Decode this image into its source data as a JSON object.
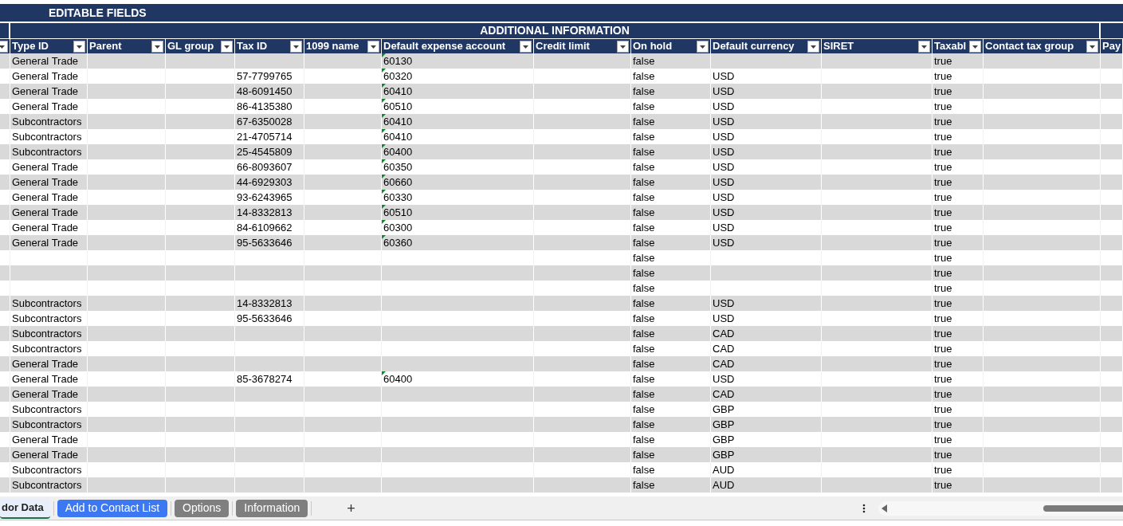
{
  "section_title": "EDITABLE FIELDS",
  "group_title": "ADDITIONAL INFORMATION",
  "columns": [
    "Type ID",
    "Parent",
    "GL group",
    "Tax ID",
    "1099 name",
    "Default expense account",
    "Credit limit",
    "On hold",
    "Default currency",
    "SIRET",
    "Taxabl",
    "Contact tax group",
    "Pay"
  ],
  "rows": [
    {
      "type": "General Trade",
      "tax_id": "",
      "account": "60130",
      "on_hold": "false",
      "currency": "",
      "taxable": "true"
    },
    {
      "type": "General Trade",
      "tax_id": "57-7799765",
      "account": "60320",
      "on_hold": "false",
      "currency": "USD",
      "taxable": "true"
    },
    {
      "type": "General Trade",
      "tax_id": "48-6091450",
      "account": "60410",
      "on_hold": "false",
      "currency": "USD",
      "taxable": "true"
    },
    {
      "type": "General Trade",
      "tax_id": "86-4135380",
      "account": "60510",
      "on_hold": "false",
      "currency": "USD",
      "taxable": "true"
    },
    {
      "type": "Subcontractors",
      "tax_id": "67-6350028",
      "account": "60410",
      "on_hold": "false",
      "currency": "USD",
      "taxable": "true"
    },
    {
      "type": "Subcontractors",
      "tax_id": "21-4705714",
      "account": "60410",
      "on_hold": "false",
      "currency": "USD",
      "taxable": "true"
    },
    {
      "type": "Subcontractors",
      "tax_id": "25-4545809",
      "account": "60400",
      "on_hold": "false",
      "currency": "USD",
      "taxable": "true"
    },
    {
      "type": "General Trade",
      "tax_id": "66-8093607",
      "account": "60350",
      "on_hold": "false",
      "currency": "USD",
      "taxable": "true"
    },
    {
      "type": "General Trade",
      "tax_id": "44-6929303",
      "account": "60660",
      "on_hold": "false",
      "currency": "USD",
      "taxable": "true"
    },
    {
      "type": "General Trade",
      "tax_id": "93-6243965",
      "account": "60330",
      "on_hold": "false",
      "currency": "USD",
      "taxable": "true"
    },
    {
      "type": "General Trade",
      "tax_id": "14-8332813",
      "account": "60510",
      "on_hold": "false",
      "currency": "USD",
      "taxable": "true"
    },
    {
      "type": "General Trade",
      "tax_id": "84-6109662",
      "account": "60300",
      "on_hold": "false",
      "currency": "USD",
      "taxable": "true"
    },
    {
      "type": "General Trade",
      "tax_id": "95-5633646",
      "account": "60360",
      "on_hold": "false",
      "currency": "USD",
      "taxable": "true"
    },
    {
      "type": "",
      "tax_id": "",
      "account": "",
      "on_hold": "false",
      "currency": "",
      "taxable": "true"
    },
    {
      "type": "",
      "tax_id": "",
      "account": "",
      "on_hold": "false",
      "currency": "",
      "taxable": "true"
    },
    {
      "type": "",
      "tax_id": "",
      "account": "",
      "on_hold": "false",
      "currency": "",
      "taxable": "true"
    },
    {
      "type": "Subcontractors",
      "tax_id": "14-8332813",
      "account": "",
      "on_hold": "false",
      "currency": "USD",
      "taxable": "true"
    },
    {
      "type": "Subcontractors",
      "tax_id": "95-5633646",
      "account": "",
      "on_hold": "false",
      "currency": "USD",
      "taxable": "true"
    },
    {
      "type": "Subcontractors",
      "tax_id": "",
      "account": "",
      "on_hold": "false",
      "currency": "CAD",
      "taxable": "true"
    },
    {
      "type": "Subcontractors",
      "tax_id": "",
      "account": "",
      "on_hold": "false",
      "currency": "CAD",
      "taxable": "true"
    },
    {
      "type": "General Trade",
      "tax_id": "",
      "account": "",
      "on_hold": "false",
      "currency": "CAD",
      "taxable": "true"
    },
    {
      "type": "General Trade",
      "tax_id": "85-3678274",
      "account": "60400",
      "on_hold": "false",
      "currency": "USD",
      "taxable": "true"
    },
    {
      "type": "General Trade",
      "tax_id": "",
      "account": "",
      "on_hold": "false",
      "currency": "CAD",
      "taxable": "true"
    },
    {
      "type": "Subcontractors",
      "tax_id": "",
      "account": "",
      "on_hold": "false",
      "currency": "GBP",
      "taxable": "true"
    },
    {
      "type": "Subcontractors",
      "tax_id": "",
      "account": "",
      "on_hold": "false",
      "currency": "GBP",
      "taxable": "true"
    },
    {
      "type": "General Trade",
      "tax_id": "",
      "account": "",
      "on_hold": "false",
      "currency": "GBP",
      "taxable": "true"
    },
    {
      "type": "General Trade",
      "tax_id": "",
      "account": "",
      "on_hold": "false",
      "currency": "GBP",
      "taxable": "true"
    },
    {
      "type": "Subcontractors",
      "tax_id": "",
      "account": "",
      "on_hold": "false",
      "currency": "AUD",
      "taxable": "true"
    },
    {
      "type": "Subcontractors",
      "tax_id": "",
      "account": "",
      "on_hold": "false",
      "currency": "AUD",
      "taxable": "true"
    }
  ],
  "sheet_tabs": [
    {
      "label": "dor Data",
      "selected": true,
      "color": "#e8eefa"
    },
    {
      "label": "Add to Contact List",
      "selected": false,
      "color": "#3b78f2"
    },
    {
      "label": "Options",
      "selected": false,
      "color": "#7f7f7f"
    },
    {
      "label": "Information",
      "selected": false,
      "color": "#7f7f7f"
    }
  ],
  "add_sheet": "+"
}
